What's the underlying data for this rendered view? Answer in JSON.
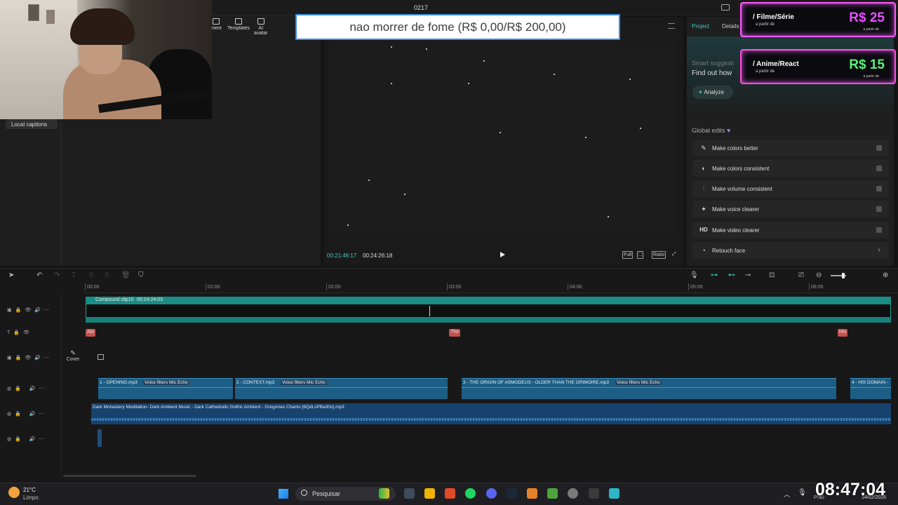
{
  "window": {
    "title": "0217"
  },
  "left_panel": {
    "tabs": [
      {
        "label": "ment",
        "icon": "elements-icon"
      },
      {
        "label": "Templates",
        "icon": "templates-icon"
      },
      {
        "label": "AI avatar",
        "icon": "ai-avatar-icon"
      }
    ],
    "local_captions": "Local captions"
  },
  "overlay": {
    "goal_text": "nao morrer de fome (R$ 0,00/R$ 200,00)",
    "cards": [
      {
        "title": "/ Filme/Série",
        "subtitle": "a partir de",
        "price": "R$ 25",
        "price_sub": "a partir de",
        "price_color": "#e94dff"
      },
      {
        "title": "/ Anime/React",
        "subtitle": "a partir de",
        "price": "R$ 15",
        "price_sub": "a partir de",
        "price_color": "#59f07a"
      }
    ]
  },
  "player": {
    "current_time": "00:21:46:17",
    "total_time": "00:24:26:18",
    "buttons": {
      "full": "Full",
      "ratio": "Ratio"
    }
  },
  "inspector": {
    "tabs": {
      "project": "Project",
      "details": "Details"
    },
    "smart_title": "Smart suggesti",
    "smart_subtitle": "Find out how",
    "analyze": "Analyze",
    "global_edits_title": "Global edits",
    "global_edits": [
      {
        "label": "Make colors better",
        "icon": "magic-wand-icon",
        "glyph": "✎"
      },
      {
        "label": "Make colors consistent",
        "icon": "color-match-icon",
        "glyph": "◐"
      },
      {
        "label": "Make volume consistent",
        "icon": "volume-sliders-icon",
        "glyph": "⫶"
      },
      {
        "label": "Make voice clearer",
        "icon": "voice-sparkle-icon",
        "glyph": "✦"
      },
      {
        "label": "Make video clearer",
        "icon": "hd-icon",
        "glyph": "HD"
      },
      {
        "label": "Retouch face",
        "icon": "face-retouch-icon",
        "glyph": "◔"
      }
    ]
  },
  "timeline": {
    "ruler": [
      "00:00",
      "01:00",
      "02:00",
      "03:00",
      "04:00",
      "05:00",
      "06:00"
    ],
    "compound": {
      "name": "Compound clip10",
      "duration": "00:24:24:03"
    },
    "captions": [
      "Abi",
      "The",
      "His"
    ],
    "cover": "Cover",
    "audio_clips": [
      {
        "name": "1 - OPENING.mp3",
        "fx": "Voice filters Mic Echo"
      },
      {
        "name": "2 - CONTEXT.mp3",
        "fx": "Voice filters Mic Echo"
      },
      {
        "name": "3 - THE ORIGIN OF ASMODEUS - OLDER THAN THE GRIMOIRE.mp3",
        "fx": "Voice filters Mic Echo"
      },
      {
        "name": "4 - HIS DOMAIN -",
        "fx": ""
      }
    ],
    "music": "Dark Monastery Meditation- Dark Ambient Music - Dark Cathedralic Gothic Ambient - Gregorian Chants [6QdLsPBa30o].mp3"
  },
  "taskbar": {
    "temp": "21°C",
    "weather": "Limpo",
    "search_placeholder": "Pesquisar",
    "time": "08:47:04",
    "lang": "PTB2",
    "date": "14/02/2026"
  },
  "colors": {
    "accent": "#3ed0c6",
    "caption_clip": "#c0504e",
    "audio_clip": "#1d5e86"
  }
}
